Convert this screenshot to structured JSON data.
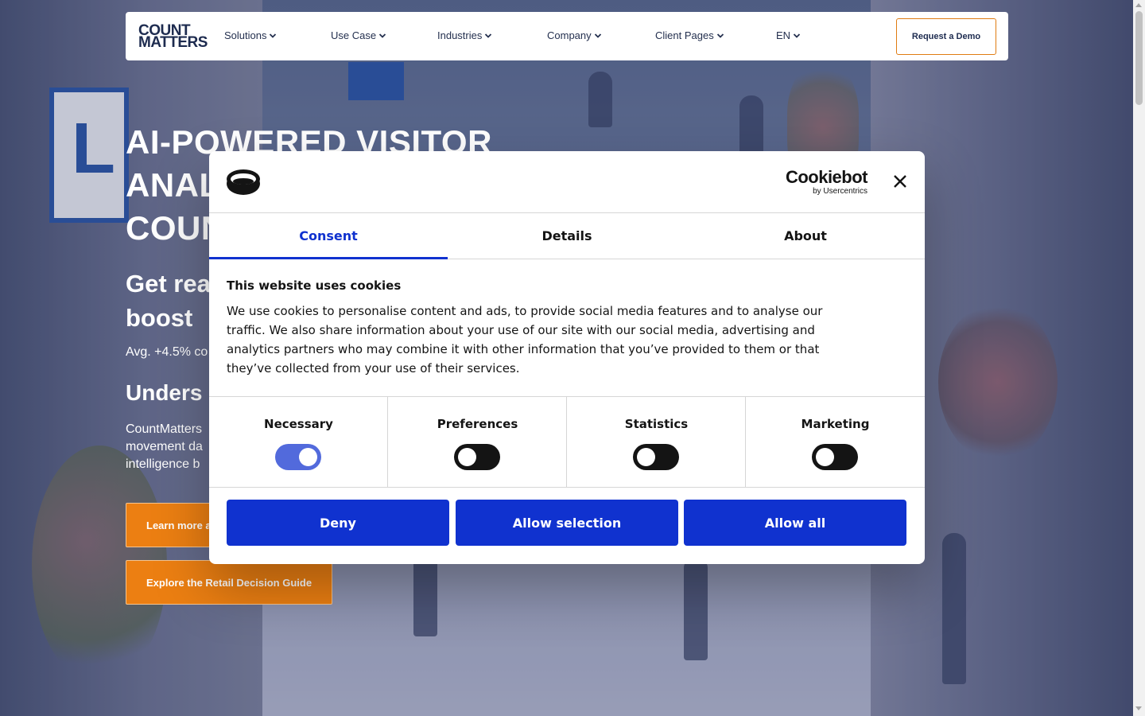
{
  "header": {
    "logo_line1": "COUNT",
    "logo_line2": "MATTERS",
    "nav": [
      {
        "label": "Solutions"
      },
      {
        "label": "Use Case"
      },
      {
        "label": "Industries"
      },
      {
        "label": "Company"
      },
      {
        "label": "Client Pages"
      },
      {
        "label": "EN"
      }
    ],
    "demo_label": "Request a Demo"
  },
  "hero": {
    "title_lines": [
      "AI-POWERED VISITOR",
      "ANAL",
      "COUN"
    ],
    "subtitle_lines": [
      "Get rea",
      "boost "
    ],
    "avg_text": "Avg. +4.5% co",
    "understand": "Unders",
    "body_lines": [
      "CountMatters",
      "movement da",
      "intelligence b"
    ],
    "cta_learn": "Learn more a",
    "cta_guide": "Explore the Retail Decision Guide"
  },
  "cookie_dialog": {
    "brand_name": "Cookiebot",
    "brand_sub": "by Usercentrics",
    "tabs": [
      {
        "label": "Consent",
        "active": true
      },
      {
        "label": "Details",
        "active": false
      },
      {
        "label": "About",
        "active": false
      }
    ],
    "title": "This website uses cookies",
    "body_lines": [
      "We use cookies to personalise content and ads, to provide social media features and to analyse our",
      "traffic. We also share information about your use of our site with our social media, advertising and",
      "analytics partners who may combine it with other information that you’ve provided to them or that",
      "they’ve collected from your use of their services."
    ],
    "toggles": [
      {
        "label": "Necessary",
        "checked": true
      },
      {
        "label": "Preferences",
        "checked": false
      },
      {
        "label": "Statistics",
        "checked": false
      },
      {
        "label": "Marketing",
        "checked": false
      }
    ],
    "buttons": {
      "deny": "Deny",
      "allow_selection": "Allow selection",
      "allow_all": "Allow all"
    }
  },
  "colors": {
    "primary_blue": "#1032cf",
    "cta_orange": "#ec7f12",
    "brand_navy": "#1d2b4f"
  },
  "icons": [
    "chevron-down-icon",
    "close-icon",
    "cookiebot-logo-icon"
  ]
}
